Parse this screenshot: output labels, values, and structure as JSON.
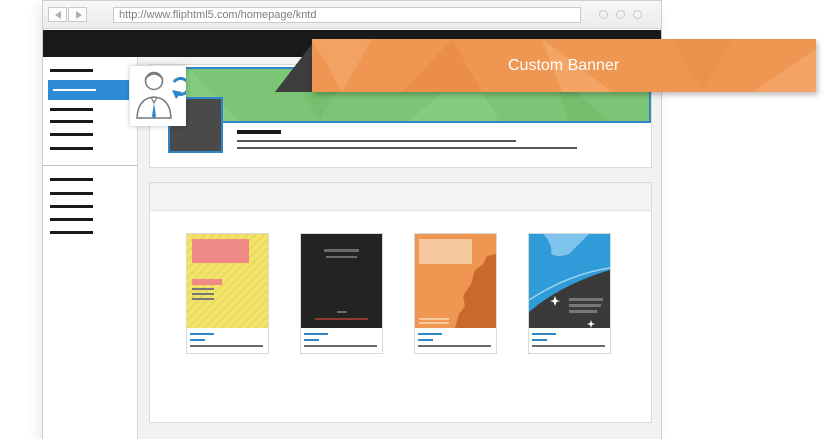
{
  "browser": {
    "url": "http://www.fliphtml5.com/homepage/kntd",
    "back_icon": "back-arrow-icon",
    "forward_icon": "forward-arrow-icon"
  },
  "sidebar": {
    "item_count": 11,
    "active_item_index": 1,
    "accent_color": "#2d8ad4"
  },
  "banner": {
    "label": "Custom Banner",
    "banner_color": "#7dc576",
    "label_color": "#ef9752",
    "selection_border_color": "#2f86c8",
    "swap_icon": "user-swap-icon"
  },
  "books": [
    {
      "cover": "yellow-pattern",
      "color": "#f2e36b"
    },
    {
      "cover": "dark",
      "color": "#232323"
    },
    {
      "cover": "orange-silhouette",
      "color": "#ef9752"
    },
    {
      "cover": "blue-planet",
      "color": "#2f9bd8"
    }
  ]
}
